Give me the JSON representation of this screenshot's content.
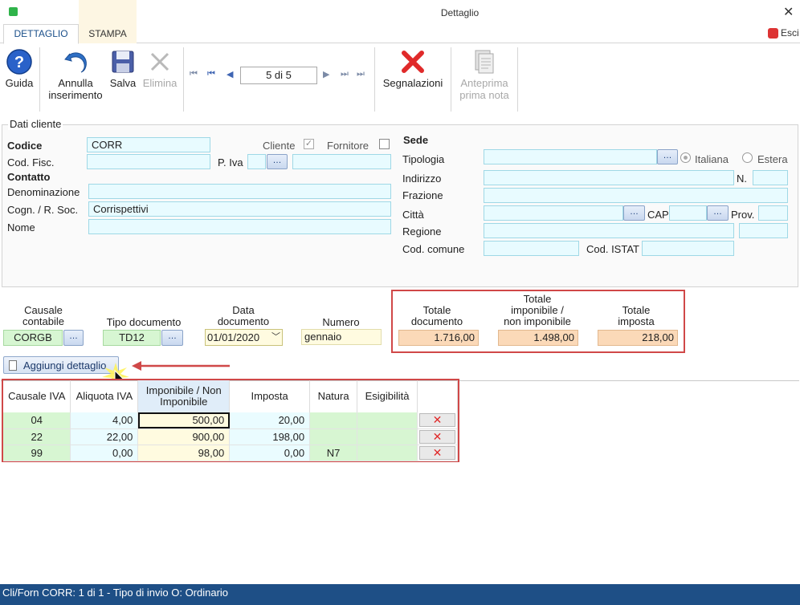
{
  "window": {
    "title": "Dettaglio",
    "close_glyph": "✕"
  },
  "tabs": [
    {
      "label": "DETTAGLIO"
    },
    {
      "label": "STAMPA"
    }
  ],
  "exit_label": "Esci",
  "toolbar": {
    "guida": "Guida",
    "annulla_line1": "Annulla",
    "annulla_line2": "inserimento",
    "salva": "Salva",
    "elimina": "Elimina",
    "record_position": "5 di 5",
    "segnalazioni": "Segnalazioni",
    "anteprima_line1": "Anteprima",
    "anteprima_line2": "prima nota"
  },
  "cliente": {
    "section_title": "Dati cliente",
    "codice_label": "Codice",
    "codice_value": "CORR",
    "cliente_label": "Cliente",
    "cliente_checked": true,
    "fornitore_label": "Fornitore",
    "fornitore_checked": false,
    "cod_fisc_label": "Cod. Fisc.",
    "p_iva_label": "P. Iva",
    "contatto_label": "Contatto",
    "denominazione_label": "Denominazione",
    "cognome_label": "Cogn. / R. Soc.",
    "cognome_value": "Corrispettivi",
    "nome_label": "Nome"
  },
  "sede": {
    "title": "Sede",
    "tipologia_label": "Tipologia",
    "italiana_label": "Italiana",
    "estera_label": "Estera",
    "indirizzo_label": "Indirizzo",
    "n_label": "N.",
    "frazione_label": "Frazione",
    "citta_label": "Città",
    "cap_label": "CAP",
    "prov_label": "Prov.",
    "regione_label": "Regione",
    "cod_comune_label": "Cod. comune",
    "cod_istat_label": "Cod. ISTAT"
  },
  "documento": {
    "causale_line1": "Causale",
    "causale_line2": "contabile",
    "causale_value": "CORGB",
    "tipo_label": "Tipo documento",
    "tipo_value": "TD12",
    "data_line1": "Data",
    "data_line2": "documento",
    "data_value": "01/01/2020",
    "numero_label": "Numero",
    "numero_value": "gennaio"
  },
  "totali": {
    "documento_line1": "Totale",
    "documento_line2": "documento",
    "documento_value": "1.716,00",
    "imponibile_line1": "Totale",
    "imponibile_line2": "imponibile /",
    "imponibile_line3": "non imponibile",
    "imponibile_value": "1.498,00",
    "imposta_line1": "Totale",
    "imposta_line2": "imposta",
    "imposta_value": "218,00"
  },
  "add_detail_label": "Aggiungi dettaglio",
  "grid": {
    "headers": {
      "causale": "Causale IVA",
      "aliquota": "Aliquota IVA",
      "imponibile_line1": "Imponibile / Non",
      "imponibile_line2": "Imponibile",
      "imposta": "Imposta",
      "natura": "Natura",
      "esigibilita": "Esigibilità"
    },
    "rows": [
      {
        "causale": "04",
        "aliquota": "4,00",
        "imponibile": "500,00",
        "imposta": "20,00",
        "natura": "",
        "esigibilita": ""
      },
      {
        "causale": "22",
        "aliquota": "22,00",
        "imponibile": "900,00",
        "imposta": "198,00",
        "natura": "",
        "esigibilita": ""
      },
      {
        "causale": "99",
        "aliquota": "0,00",
        "imponibile": "98,00",
        "imposta": "0,00",
        "natura": "N7",
        "esigibilita": ""
      }
    ]
  },
  "status_bar": {
    "text": "Cli/Forn CORR: 1 di 1 - Tipo di invio O: Ordinario"
  },
  "colors": {
    "accent": "#1a4f8a",
    "highlight_border": "#d04848",
    "status_bg": "#1e4f86"
  }
}
